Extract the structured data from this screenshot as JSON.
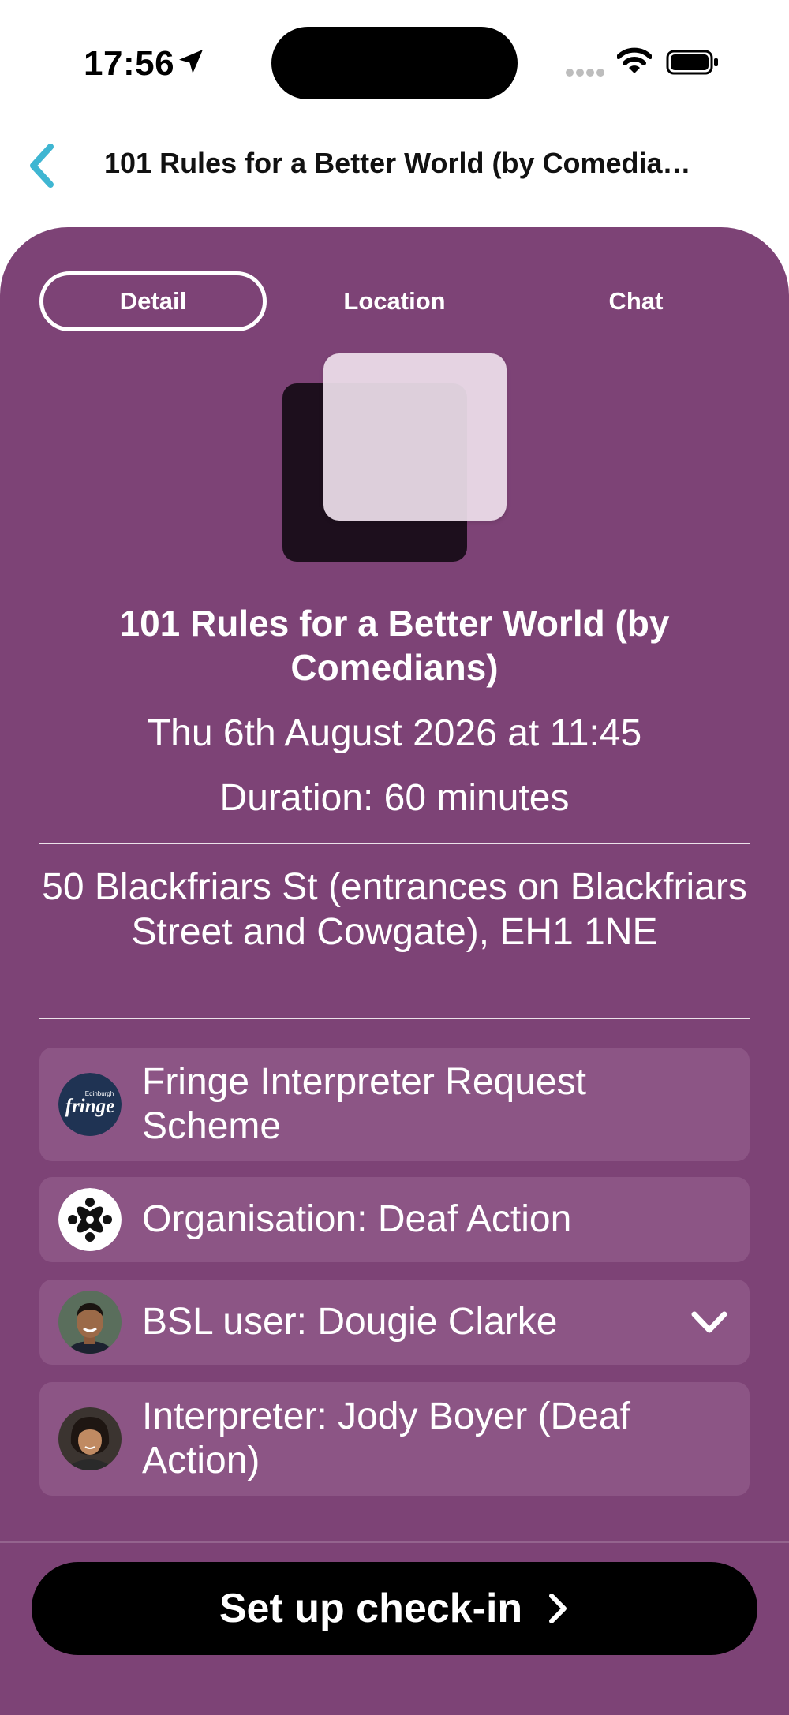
{
  "status_bar": {
    "time": "17:56"
  },
  "header": {
    "title": "101 Rules for a Better World (by Comedians)"
  },
  "tabs": [
    {
      "label": "Detail",
      "active": true
    },
    {
      "label": "Location",
      "active": false
    },
    {
      "label": "Chat",
      "active": false
    }
  ],
  "event": {
    "title": "101 Rules for a Better World (by Comedians)",
    "date": "Thu 6th August 2026 at 11:45",
    "duration": "Duration: 60 minutes",
    "address": "50 Blackfriars St (entrances on Blackfriars Street and Cowgate), EH1 1NE"
  },
  "details": {
    "scheme": "Fringe Interpreter Request Scheme",
    "organisation": "Organisation: Deaf Action",
    "bsl_user": "BSL user: Dougie Clarke",
    "interpreter": "Interpreter: Jody Boyer (Deaf Action)"
  },
  "fringe_logo_text": {
    "top": "Edinburgh",
    "main": "fringe"
  },
  "actions": {
    "checkin_label": "Set up check-in"
  },
  "colors": {
    "card_background": "#7d4376",
    "row_background": "#8c5585",
    "back_accent": "#3fb6d2",
    "button_background": "#000000"
  },
  "icons": [
    "location-arrow-icon",
    "signal-dots-icon",
    "wifi-icon",
    "battery-icon",
    "back-chevron-icon",
    "fringe-logo-icon",
    "deaf-action-logo-icon",
    "chevron-down-icon",
    "chevron-right-icon"
  ]
}
